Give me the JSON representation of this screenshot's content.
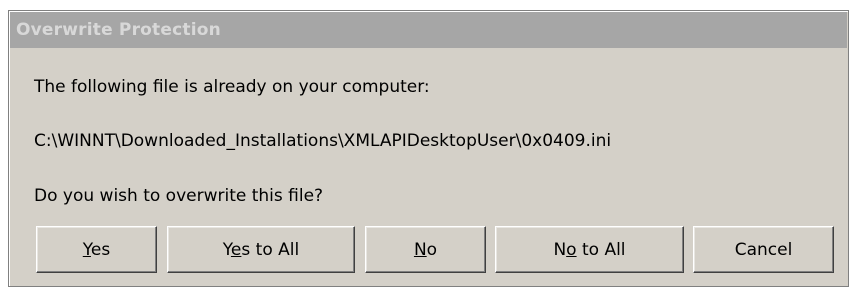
{
  "window": {
    "title": "Overwrite Protection"
  },
  "message": {
    "line1": "The following file is already on your computer:",
    "file_path": "C:\\WINNT\\Downloaded_Installations\\XMLAPIDesktopUser\\0x0409.ini",
    "question": "Do you wish to overwrite this file?"
  },
  "buttons": {
    "yes": {
      "pre": "",
      "mnemonic": "Y",
      "post": "es"
    },
    "yes_to_all": {
      "pre": "Y",
      "mnemonic": "e",
      "post": "s to All"
    },
    "no": {
      "pre": "",
      "mnemonic": "N",
      "post": "o"
    },
    "no_to_all": {
      "pre": "N",
      "mnemonic": "o",
      "post": " to All"
    },
    "cancel": {
      "label": "Cancel"
    }
  },
  "colors": {
    "dialog_bg": "#d4d0c8",
    "titlebar_bg": "#a6a6a6",
    "title_text": "#d8d8d8"
  }
}
